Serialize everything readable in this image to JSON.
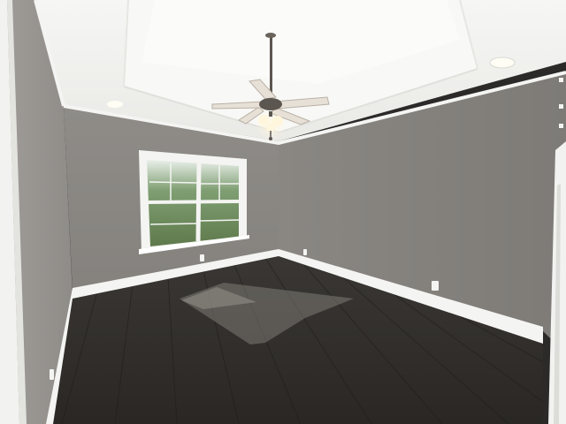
{
  "scene": {
    "kind": "photo-empty-room",
    "colors": {
      "ceiling": "#f1f1ef",
      "tray_ceiling": "#f6f6f4",
      "back_wall": "#8b8884",
      "right_wall": "#8a8783",
      "left_wall": "#96938f",
      "trim": "#f4f4f2",
      "floor": "#2f2c2a",
      "floor_light": "#6e6b66",
      "window_view": "#6f8a5a",
      "fan_metal": "#5c5650",
      "fan_blade": "#e7e0d6",
      "fan_light": "#fff6dd"
    },
    "objects": [
      "ceiling-fan-icon",
      "recessed-light-icon",
      "window-icon",
      "door-frame-icon",
      "baseboard-icon",
      "outlet-icon"
    ]
  }
}
